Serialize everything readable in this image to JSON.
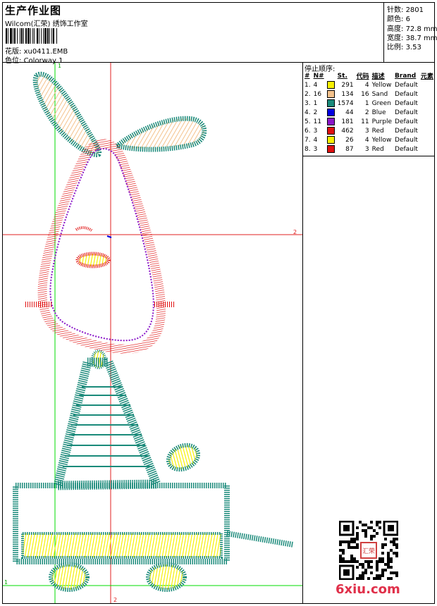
{
  "header": {
    "title": "生产作业图",
    "software": "Wilcom(汇荣) 绣饰工作室",
    "design_label": "花版:",
    "design_file": "xu0411.EMB",
    "colorway_label": "色位:",
    "colorway": "Colorway 1"
  },
  "specs": {
    "stitches_label": "针数:",
    "stitches": "2801",
    "colors_label": "颜色:",
    "colors": "6",
    "height_label": "高度:",
    "height": "72.8 mm",
    "width_label": "宽度:",
    "width": "38.7 mm",
    "scale_label": "比例:",
    "scale": "3.53"
  },
  "stop_sequence": {
    "title": "停止顺序:",
    "columns": [
      "#",
      "N#",
      "",
      "St.",
      "代码",
      "描述",
      "Brand",
      "元素"
    ],
    "rows": [
      {
        "idx": "1.",
        "n": "4",
        "color": "#f7f000",
        "st": "291",
        "code": "4",
        "desc": "Yellow",
        "brand": "Default"
      },
      {
        "idx": "2.",
        "n": "16",
        "color": "#f4c28c",
        "st": "134",
        "code": "16",
        "desc": "Sand",
        "brand": "Default"
      },
      {
        "idx": "3.",
        "n": "1",
        "color": "#1a8a7a",
        "st": "1574",
        "code": "1",
        "desc": "Green",
        "brand": "Default"
      },
      {
        "idx": "4.",
        "n": "2",
        "color": "#0000e0",
        "st": "44",
        "code": "2",
        "desc": "Blue",
        "brand": "Default"
      },
      {
        "idx": "5.",
        "n": "11",
        "color": "#8a16c8",
        "st": "181",
        "code": "11",
        "desc": "Purple",
        "brand": "Default"
      },
      {
        "idx": "6.",
        "n": "3",
        "color": "#e01010",
        "st": "462",
        "code": "3",
        "desc": "Red",
        "brand": "Default"
      },
      {
        "idx": "7.",
        "n": "4",
        "color": "#f7f000",
        "st": "26",
        "code": "4",
        "desc": "Yellow",
        "brand": "Default"
      },
      {
        "idx": "8.",
        "n": "3",
        "color": "#e01010",
        "st": "87",
        "code": "3",
        "desc": "Red",
        "brand": "Default"
      }
    ]
  },
  "guides": {
    "v1": "1",
    "h2": "2",
    "h1": "1",
    "v2": "2"
  },
  "watermark": "6xiu.com",
  "qr_seal": "汇荣"
}
